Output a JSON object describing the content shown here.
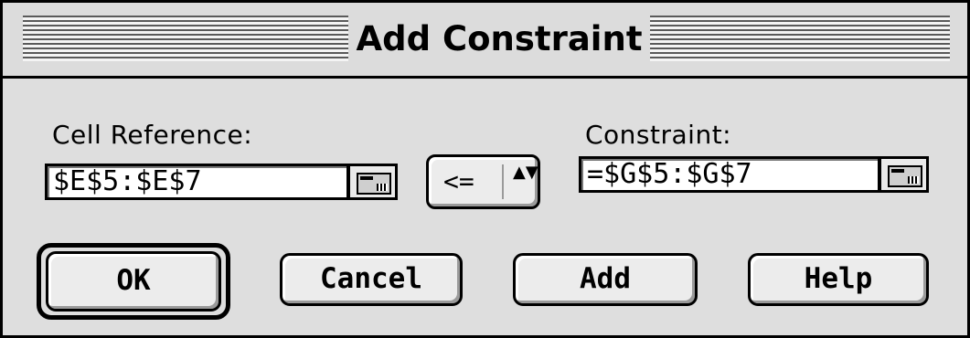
{
  "dialog": {
    "title": "Add Constraint"
  },
  "cell_reference": {
    "label": "Cell Reference:",
    "value": "$E$5:$E$7"
  },
  "operator": {
    "selected": "<=",
    "arrows_glyph": "▲▼"
  },
  "constraint": {
    "label": "Constraint:",
    "value": "=$G$5:$G$7"
  },
  "buttons": {
    "ok": "OK",
    "cancel": "Cancel",
    "add": "Add",
    "help": "Help"
  }
}
